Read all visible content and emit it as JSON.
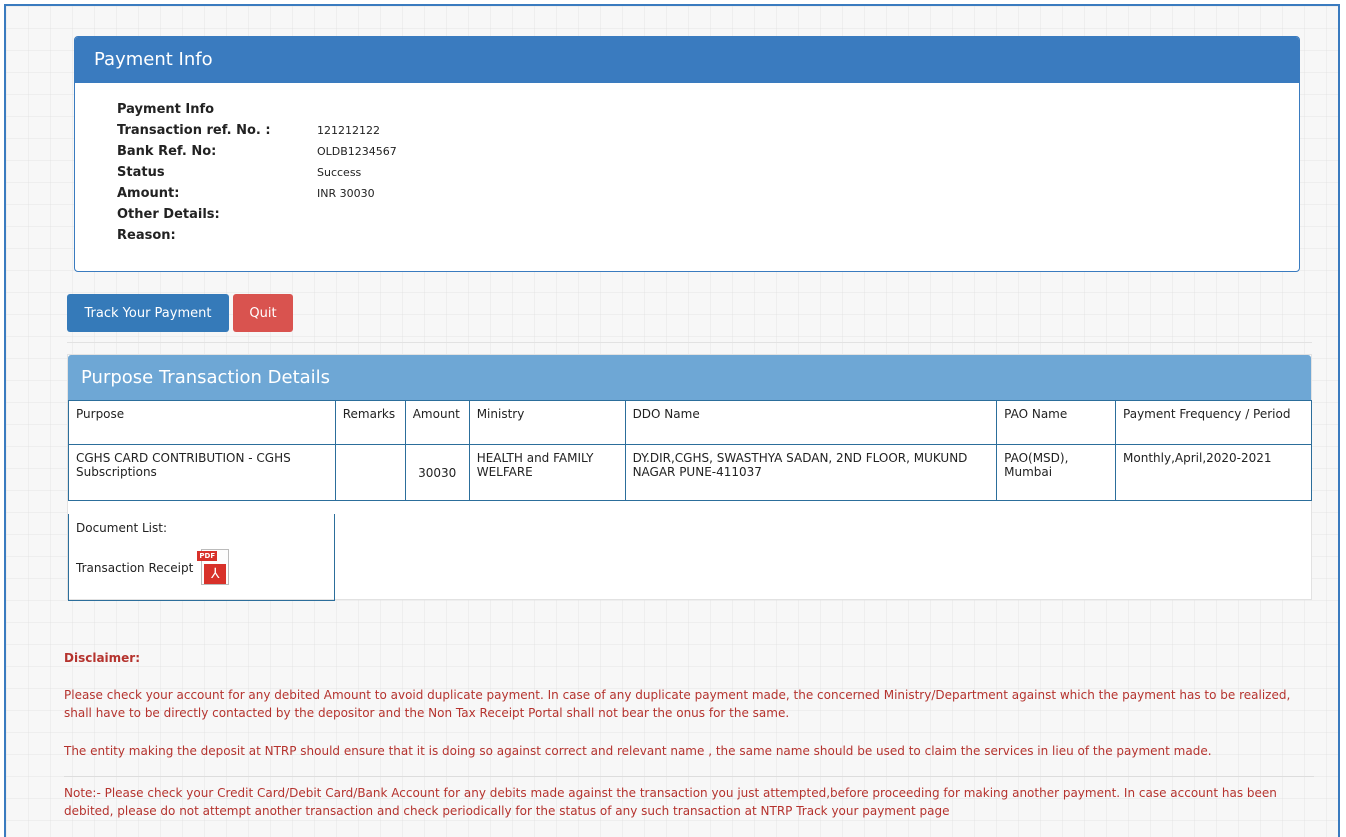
{
  "payment_info": {
    "heading": "Payment Info",
    "rows": [
      {
        "label": "Payment Info",
        "value": ""
      },
      {
        "label": "Transaction ref. No. :",
        "value": "121212122"
      },
      {
        "label": "Bank Ref. No:",
        "value": "OLDB1234567"
      },
      {
        "label": "Status",
        "value": "Success"
      },
      {
        "label": "Amount:",
        "value": "INR 30030"
      },
      {
        "label": "Other Details:",
        "value": ""
      },
      {
        "label": "Reason:",
        "value": ""
      }
    ]
  },
  "buttons": {
    "track_label": "Track Your Payment",
    "quit_label": "Quit"
  },
  "purpose": {
    "heading": "Purpose Transaction Details",
    "columns": [
      "Purpose",
      "Remarks",
      "Amount",
      "Ministry",
      "DDO Name",
      "PAO Name",
      "Payment Frequency / Period"
    ],
    "row": {
      "purpose": "CGHS CARD CONTRIBUTION - CGHS Subscriptions",
      "remarks": "",
      "amount": "30030",
      "ministry": "HEALTH and FAMILY WELFARE",
      "ddo_name": "DY.DIR,CGHS, SWASTHYA SADAN, 2ND FLOOR, MUKUND NAGAR PUNE-411037",
      "pao_name": "PAO(MSD), Mumbai",
      "frequency": "Monthly,April,2020-2021"
    },
    "document_list_label": "Document List:",
    "document_name": "Transaction Receipt",
    "document_icon": "pdf-icon",
    "pdf_tag": "PDF"
  },
  "disclaimer": {
    "title": "Disclaimer:",
    "p1": "Please check your account for any debited Amount to avoid duplicate payment. In case of any duplicate payment made, the concerned Ministry/Department against which the payment has to be realized, shall have to be directly contacted by the depositor and the Non Tax Receipt Portal shall not bear the onus for the same.",
    "p2": "The entity making the deposit at NTRP should ensure that it is doing so against correct and relevant name , the same name should be used to claim the services in lieu of the payment made.",
    "note": "Note:- Please check your Credit Card/Debit Card/Bank Account for any debits made against the transaction you just attempted,before proceeding for making another payment. In case account has been debited, please do not attempt another transaction and check periodically for the status of any such transaction at NTRP Track your payment page"
  },
  "colors": {
    "primary": "#3a7bbf",
    "header_light": "#6ea7d5",
    "danger": "#d9534f",
    "disclaimer_text": "#b5332e"
  }
}
